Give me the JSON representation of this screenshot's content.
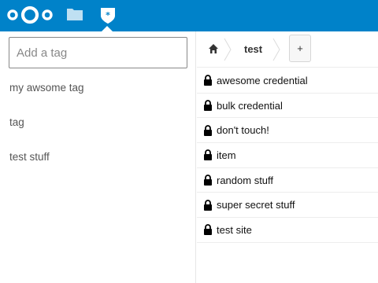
{
  "header": {
    "logo_icon": "nextcloud-logo",
    "apps": [
      {
        "name": "Files",
        "icon": "folder-icon"
      },
      {
        "name": "Passwords",
        "icon": "passman-shield-icon",
        "active": true
      }
    ],
    "brand_color": "#0082c9"
  },
  "sidebar": {
    "tag_input_placeholder": "Add a tag",
    "tag_input_value": "",
    "tags": [
      "my awsome tag",
      "tag",
      "test stuff"
    ]
  },
  "breadcrumb": {
    "home_icon": "home-icon",
    "current": "test",
    "add_label": "+"
  },
  "credentials": [
    "awesome credential",
    "bulk credential",
    "don't touch!",
    "item",
    "random stuff",
    "super secret stuff",
    "test site"
  ],
  "colors": {
    "lock": "#000000",
    "row_border": "#ededed"
  }
}
